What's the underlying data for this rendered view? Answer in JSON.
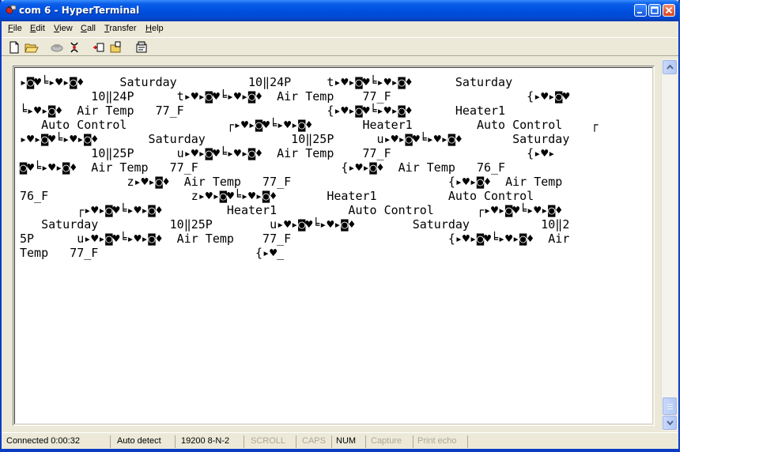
{
  "window": {
    "title": "com 6 - HyperTerminal"
  },
  "menu": {
    "file": "File",
    "edit": "Edit",
    "view": "View",
    "call": "Call",
    "transfer": "Transfer",
    "help": "Help"
  },
  "toolbar": {
    "icons": [
      "new-document-icon",
      "open-folder-icon",
      "call-icon",
      "disconnect-icon",
      "send-icon",
      "receive-icon",
      "properties-icon"
    ]
  },
  "terminal": {
    "lines": [
      "▸◙♥╘▸♥▸◙♦     Saturday          10‖24P     t▸♥▸◙♥╘▸♥▸◙♦      Saturday",
      "          10‖24P      t▸♥▸◙♥╘▸♥▸◙♦  Air Temp    77_F                   {▸♥▸◙♥",
      "╘▸♥▸◙♦  Air Temp   77_F                    {▸♥▸◙♥╘▸♥▸◙♦      Heater1",
      "   Auto Control              ┌▸♥▸◙♥╘▸♥▸◙♦       Heater1         Auto Control    ┌",
      "▸♥▸◙♥╘▸♥▸◙♦       Saturday            10‖25P      u▸♥▸◙♥╘▸♥▸◙♦       Saturday",
      "          10‖25P      u▸♥▸◙♥╘▸♥▸◙♦  Air Temp    77_F                   {▸♥▸",
      "◙♥╘▸♥▸◙♦  Air Temp   77_F                    {▸♥▸◙♦  Air Temp   76_F",
      "               z▸♥▸◙♦  Air Temp   77_F                      {▸♥▸◙♦  Air Temp",
      "76_F                    z▸♥▸◙♥╘▸♥▸◙♦       Heater1          Auto Control",
      "        ┌▸♥▸◙♥╘▸♥▸◙♦         Heater1          Auto Control      ┌▸♥▸◙♥╘▸♥▸◙♦",
      "   Saturday          10‖25P        u▸♥▸◙♥╘▸♥▸◙♦        Saturday          10‖2",
      "5P      u▸♥▸◙♥╘▸♥▸◙♦  Air Temp    77_F                      {▸♥▸◙♥╘▸♥▸◙♦  Air",
      "Temp   77_F                      {▸♥_"
    ]
  },
  "status": {
    "connected": "Connected 0:00:32",
    "detect": "Auto detect",
    "settings": "19200 8-N-2",
    "scroll": "SCROLL",
    "caps": "CAPS",
    "num": "NUM",
    "capture": "Capture",
    "print_echo": "Print echo"
  },
  "colors": {
    "titlebar": "#0050e0",
    "frame": "#ece9d8",
    "disabled_text": "#aca899"
  }
}
